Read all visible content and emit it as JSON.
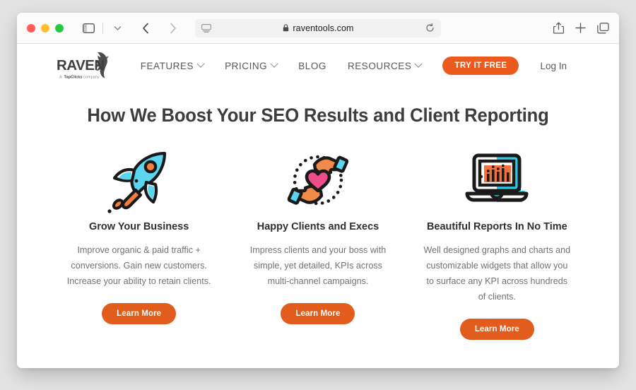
{
  "browser": {
    "traffic_lights": [
      "close",
      "minimize",
      "maximize"
    ],
    "url": "raventools.com",
    "lock_icon": "lock-icon",
    "reload_icon": "reload-icon",
    "sidebar_icon": "sidebar-toggle-icon",
    "back_icon": "back-arrow-icon",
    "forward_icon": "forward-arrow-icon",
    "share_icon": "share-icon",
    "new_tab_icon": "plus-icon",
    "tab_overview_icon": "tab-overview-icon",
    "reader_icon": "reader-view-icon"
  },
  "site": {
    "logo": {
      "wordmark": "RAVEN",
      "tagline": "A TapClicks company"
    },
    "nav": [
      {
        "label": "FEATURES",
        "has_dropdown": true
      },
      {
        "label": "PRICING",
        "has_dropdown": true
      },
      {
        "label": "BLOG",
        "has_dropdown": false
      },
      {
        "label": "RESOURCES",
        "has_dropdown": true
      }
    ],
    "cta_label": "TRY IT FREE",
    "login_label": "Log In",
    "accent_color": "#ea5b1d",
    "cyan_color": "#4fd2e8",
    "pink_color": "#ee4d8a"
  },
  "main": {
    "headline": "How We Boost Your SEO Results and Client Reporting",
    "columns": [
      {
        "icon": "rocket-icon",
        "title": "Grow Your Business",
        "body": "Improve organic & paid traffic + conversions. Gain new customers. Increase your ability to retain clients.",
        "button_label": "Learn More"
      },
      {
        "icon": "hands-heart-icon",
        "title": "Happy Clients and Execs",
        "body": "Impress clients and your boss with simple, yet detailed, KPIs across multi-channel campaigns.",
        "button_label": "Learn More"
      },
      {
        "icon": "laptop-chart-icon",
        "title": "Beautiful Reports In No Time",
        "body": "Well designed graphs and charts and customizable widgets that allow you to surface any KPI across hundreds of clients.",
        "button_label": "Learn More"
      }
    ]
  }
}
